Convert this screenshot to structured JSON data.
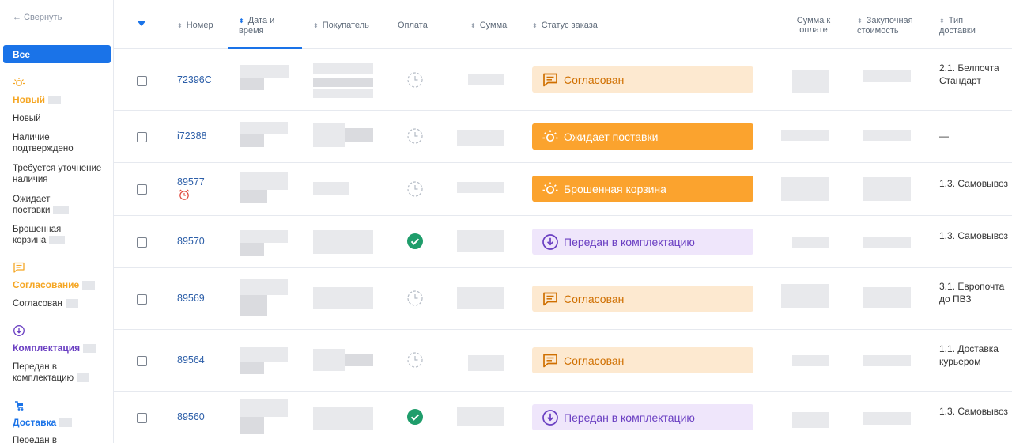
{
  "sidebar": {
    "collapse": "← Свернуть",
    "all": "Все",
    "groups": [
      {
        "title": "Новый",
        "color": "#f5a623",
        "icon": "sun-icon",
        "items": [
          "Новый",
          "Наличие подтверждено",
          "Требуется уточнение наличия",
          "Ожидает поставки",
          "Брошенная корзина"
        ]
      },
      {
        "title": "Согласование",
        "color": "#f5a623",
        "icon": "chat-icon",
        "items": [
          "Согласован"
        ]
      },
      {
        "title": "Комплектация",
        "color": "#6a3fc2",
        "icon": "download-circle-icon",
        "items": [
          "Передан в комплектацию"
        ]
      },
      {
        "title": "Доставка",
        "color": "#1a73e8",
        "icon": "delivery-icon",
        "items": [
          "Передан в"
        ]
      }
    ]
  },
  "table": {
    "headers": {
      "number": "Номер",
      "datetime": "Дата и время",
      "customer": "Покупатель",
      "payment": "Оплата",
      "sum": "Сумма",
      "status": "Статус заказа",
      "to_pay": "Сумма к оплате",
      "purchase": "Закупочная стоимость",
      "delivery": "Тип доставки"
    },
    "rows": [
      {
        "number": "72396C",
        "status": "Согласован",
        "delivery": "2.1. Белпочта Стандарт"
      },
      {
        "number": "i72388",
        "status": "Ожидает поставки",
        "delivery": "—"
      },
      {
        "number": "89577",
        "status": "Брошенная корзина",
        "delivery": "1.3. Самовывоз"
      },
      {
        "number": "89570",
        "status": "Передан в комплектацию",
        "delivery": "1.3. Самовывоз"
      },
      {
        "number": "89569",
        "status": "Согласован",
        "delivery": "3.1. Европочта до ПВЗ"
      },
      {
        "number": "89564",
        "status": "Согласован",
        "delivery": "1.1. Доставка курьером"
      },
      {
        "number": "89560",
        "status": "Передан в комплектацию",
        "delivery": "1.3. Самовывоз"
      }
    ]
  },
  "colors": {
    "accent": "#1a73e8",
    "sogl_bg": "#fde9d0",
    "wait_bg": "#fba32e",
    "komp_bg": "#efe6fb",
    "paid": "#1f9d6b"
  }
}
